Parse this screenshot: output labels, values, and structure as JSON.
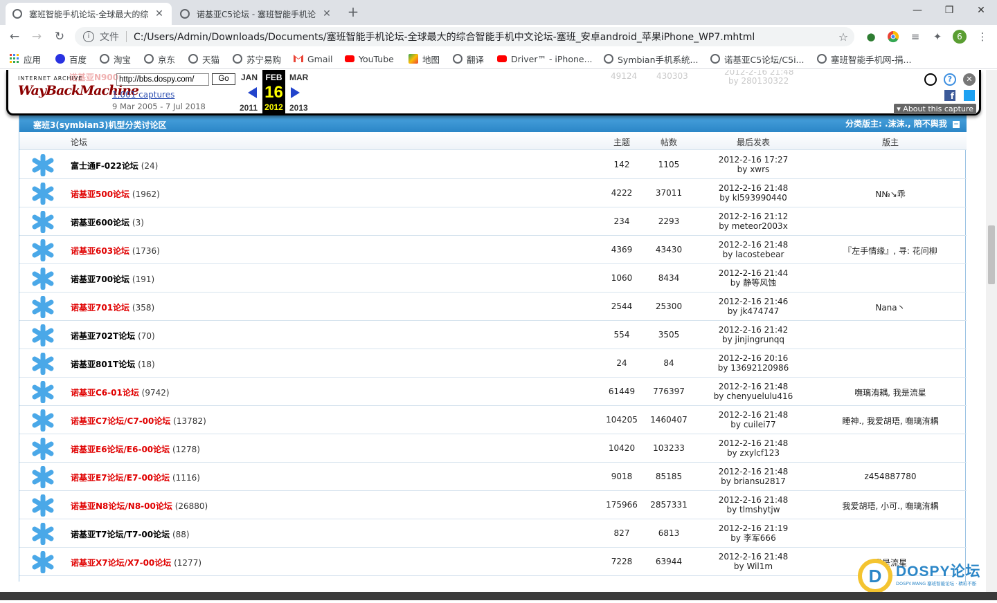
{
  "browser": {
    "tabs": [
      {
        "title": "塞班智能手机论坛-全球最大的综",
        "active": true
      },
      {
        "title": "诺基亚C5论坛 - 塞班智能手机论",
        "active": false
      }
    ],
    "address": {
      "label": "文件",
      "url": "C:/Users/Admin/Downloads/Documents/塞班智能手机论坛-全球最大的综合智能手机中文论坛-塞班_安卓android_苹果iPhone_WP7.mhtml"
    },
    "profile_initial": "6",
    "bookmarks": [
      {
        "label": "应用",
        "icon": "apps-grid-icon"
      },
      {
        "label": "百度",
        "icon": "baidu-paw-icon"
      },
      {
        "label": "淘宝",
        "icon": "globe-icon"
      },
      {
        "label": "京东",
        "icon": "globe-icon"
      },
      {
        "label": "天猫",
        "icon": "globe-icon"
      },
      {
        "label": "苏宁易购",
        "icon": "globe-icon"
      },
      {
        "label": "Gmail",
        "icon": "gmail-icon"
      },
      {
        "label": "YouTube",
        "icon": "youtube-icon"
      },
      {
        "label": "地图",
        "icon": "maps-icon"
      },
      {
        "label": "翻译",
        "icon": "globe-icon"
      },
      {
        "label": "Driver™ - iPhone...",
        "icon": "youtube-icon"
      },
      {
        "label": "Symbian手机系统...",
        "icon": "globe-icon"
      },
      {
        "label": "诺基亚C5论坛/C5i...",
        "icon": "globe-icon"
      },
      {
        "label": "塞班智能手机网-捐...",
        "icon": "globe-icon"
      }
    ]
  },
  "wayback": {
    "faded_row": {
      "name": "诺基亚N900",
      "topics": "49124",
      "posts": "430303",
      "date": "2012-2-16 21:48",
      "by": "by 280130322"
    },
    "logo_top": "INTERNET ARCHIVE",
    "logo_main": "WayBackMachine",
    "url_value": "http://bbs.dospy.com/",
    "go_label": "Go",
    "captures": "1,001 captures",
    "range": "9 Mar 2005 - 7 Jul 2018",
    "months": {
      "prev": "JAN",
      "current": "FEB",
      "next": "MAR"
    },
    "day": "16",
    "years": {
      "prev": "2011",
      "current": "2012",
      "next": "2013"
    },
    "about": "About this capture"
  },
  "category": {
    "title": "塞班3(symbian3)机型分类讨论区",
    "moderators": "分类版主: .沫沫., 陪不舆我"
  },
  "columns": {
    "forum": "论坛",
    "topics": "主题",
    "posts": "帖数",
    "last_post": "最后发表",
    "moderators": "版主"
  },
  "forums": [
    {
      "name": "富士通F-022论坛",
      "count": "(24)",
      "color": "black",
      "topics": "142",
      "posts": "1105",
      "date": "2012-2-16 17:27",
      "by": "by xwrs",
      "mods": ""
    },
    {
      "name": "诺基亚500论坛",
      "count": "(1962)",
      "color": "red",
      "topics": "4222",
      "posts": "37011",
      "date": "2012-2-16 21:48",
      "by": "by kl593990440",
      "mods": "N№↘乖"
    },
    {
      "name": "诺基亚600论坛",
      "count": "(3)",
      "color": "black",
      "topics": "234",
      "posts": "2293",
      "date": "2012-2-16 21:12",
      "by": "by meteor2003x",
      "mods": ""
    },
    {
      "name": "诺基亚603论坛",
      "count": "(1736)",
      "color": "red",
      "topics": "4369",
      "posts": "43430",
      "date": "2012-2-16 21:48",
      "by": "by lacostebear",
      "mods": "『左手情缘』, 寻: 花问柳"
    },
    {
      "name": "诺基亚700论坛",
      "count": "(191)",
      "color": "black",
      "topics": "1060",
      "posts": "8434",
      "date": "2012-2-16 21:44",
      "by": "by 静等风蚀",
      "mods": ""
    },
    {
      "name": "诺基亚701论坛",
      "count": "(358)",
      "color": "red",
      "topics": "2544",
      "posts": "25300",
      "date": "2012-2-16 21:46",
      "by": "by jk474747",
      "mods": "Nana丶"
    },
    {
      "name": "诺基亚702T论坛",
      "count": "(70)",
      "color": "black",
      "topics": "554",
      "posts": "3505",
      "date": "2012-2-16 21:42",
      "by": "by jinjingrunqq",
      "mods": ""
    },
    {
      "name": "诺基亚801T论坛",
      "count": "(18)",
      "color": "black",
      "topics": "24",
      "posts": "84",
      "date": "2012-2-16 20:16",
      "by": "by 13692120986",
      "mods": ""
    },
    {
      "name": "诺基亚C6-01论坛",
      "count": "(9742)",
      "color": "red",
      "topics": "61449",
      "posts": "776397",
      "date": "2012-2-16 21:48",
      "by": "by chenyuelulu416",
      "mods": "嘸璃洧耦, 我是流星"
    },
    {
      "name": "诺基亚C7论坛/C7-00论坛",
      "count": "(13782)",
      "color": "red",
      "topics": "104205",
      "posts": "1460407",
      "date": "2012-2-16 21:48",
      "by": "by cuilei77",
      "mods": "睡神., 我爱胡珸, 嘸璃洧耦"
    },
    {
      "name": "诺基亚E6论坛/E6-00论坛",
      "count": "(1278)",
      "color": "red",
      "topics": "10420",
      "posts": "103233",
      "date": "2012-2-16 21:48",
      "by": "by zxylcf123",
      "mods": ""
    },
    {
      "name": "诺基亚E7论坛/E7-00论坛",
      "count": "(1116)",
      "color": "red",
      "topics": "9018",
      "posts": "85185",
      "date": "2012-2-16 21:48",
      "by": "by briansu2817",
      "mods": "z454887780"
    },
    {
      "name": "诺基亚N8论坛/N8-00论坛",
      "count": "(26880)",
      "color": "red",
      "topics": "175966",
      "posts": "2857331",
      "date": "2012-2-16 21:48",
      "by": "by tlmshytjw",
      "mods": "我爱胡珸, 小可., 嘸璃洧耦"
    },
    {
      "name": "诺基亚T7论坛/T7-00论坛",
      "count": "(88)",
      "color": "black",
      "topics": "827",
      "posts": "6813",
      "date": "2012-2-16 21:19",
      "by": "by 李军666",
      "mods": ""
    },
    {
      "name": "诺基亚X7论坛/X7-00论坛",
      "count": "(1277)",
      "color": "red",
      "topics": "7228",
      "posts": "63944",
      "date": "2012-2-16 21:48",
      "by": "by Wil1m",
      "mods": "我是流星"
    }
  ],
  "watermark": {
    "brand": "DOSPY论坛",
    "sub": "DOSPY.WANG 塞班智能论坛 · 精彩不断"
  },
  "colors": {
    "accent_blue": "#2b86c7",
    "forum_red": "#e00000",
    "forum_icon": "#4aa8e8"
  }
}
